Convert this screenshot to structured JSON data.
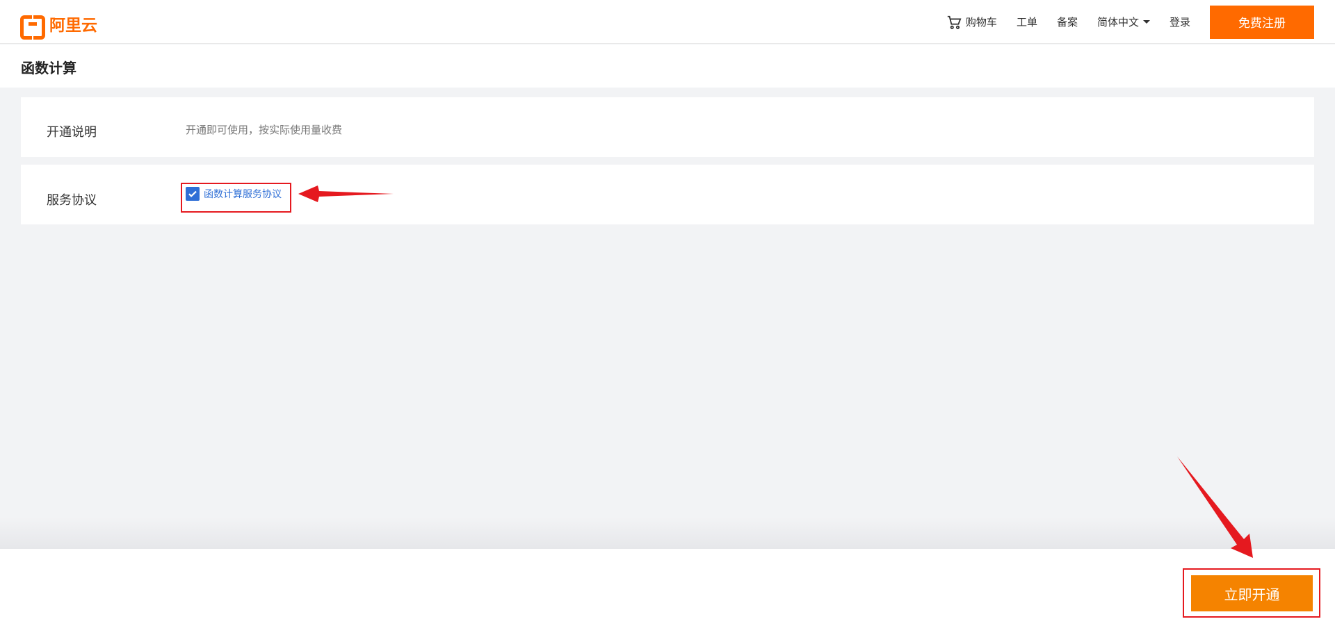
{
  "header": {
    "logo_text": "阿里云",
    "nav": [
      {
        "label": "购物车"
      },
      {
        "label": "工单"
      },
      {
        "label": "备案"
      },
      {
        "label": "简体中文"
      },
      {
        "label": "登录"
      }
    ],
    "signup_button": "免费注册"
  },
  "page": {
    "title": "函数计算"
  },
  "panels": {
    "description": {
      "label": "开通说明",
      "text": "开通即可使用，按实际使用量收费"
    },
    "agreement": {
      "label": "服务协议",
      "checkbox_text": "函数计算服务协议",
      "checked": true
    }
  },
  "footer": {
    "open_button": "立即开通"
  },
  "colors": {
    "brand": "#ff6a00",
    "agreement_blue": "#2f6fd6",
    "highlight_red": "#e5191f",
    "open_button": "#f58300"
  }
}
